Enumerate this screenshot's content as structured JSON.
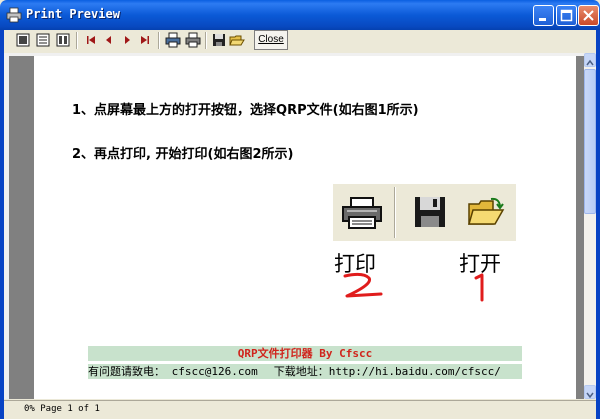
{
  "window": {
    "title": "Print Preview",
    "title_icon": "printer-icon",
    "colors": {
      "titlebar": "#0b5ad7",
      "close": "#c94a2a"
    }
  },
  "toolbar": {
    "buttons": [
      "page-view-icon",
      "two-page-icon",
      "fit-width-icon",
      "first-page-icon",
      "prev-page-icon",
      "next-page-icon",
      "last-page-icon",
      "printer-setup-icon",
      "print-icon",
      "save-icon",
      "open-icon"
    ],
    "close_label": "Close"
  },
  "page": {
    "line1": "1、点屏幕最上方的打开按钮，选择QRP文件(如右图1所示)",
    "line2": "2、再点打印, 开始打印(如右图2所示)",
    "demo": {
      "print_label": "打印",
      "open_label": "打开",
      "print_number": "2",
      "open_number": "1",
      "number_color": "#e01c1c"
    },
    "footer": {
      "title": "QRP文件打印器 By Cfscc",
      "contact": "有问题请致电： cfscc@126.com",
      "download": "下载地址：http://hi.baidu.com/cfscc/",
      "background": "#c8e2cc"
    }
  },
  "status": {
    "text": "0% Page 1 of 1"
  }
}
